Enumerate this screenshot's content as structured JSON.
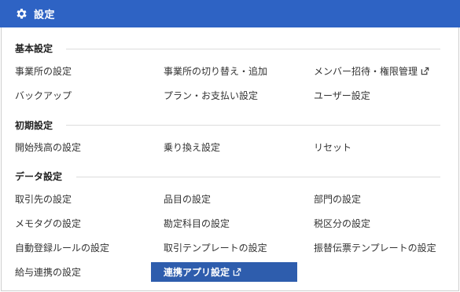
{
  "header": {
    "title": "設定"
  },
  "sections": [
    {
      "title": "基本設定",
      "items": [
        {
          "label": "事業所の設定"
        },
        {
          "label": "事業所の切り替え・追加"
        },
        {
          "label": "メンバー招待・権限管理"
        },
        {
          "label": "バックアップ"
        },
        {
          "label": "プラン・お支払い設定"
        },
        {
          "label": "ユーザー設定"
        }
      ]
    },
    {
      "title": "初期設定",
      "items": [
        {
          "label": "開始残高の設定"
        },
        {
          "label": "乗り換え設定"
        },
        {
          "label": "リセット"
        }
      ]
    },
    {
      "title": "データ設定",
      "items": [
        {
          "label": "取引先の設定"
        },
        {
          "label": "品目の設定"
        },
        {
          "label": "部門の設定"
        },
        {
          "label": "メモタグの設定"
        },
        {
          "label": "勘定科目の設定"
        },
        {
          "label": "税区分の設定"
        },
        {
          "label": "自動登録ルールの設定"
        },
        {
          "label": "取引テンプレートの設定"
        },
        {
          "label": "振替伝票テンプレートの設定"
        },
        {
          "label": "給与連携の設定"
        },
        {
          "label": "連携アプリ設定"
        }
      ]
    }
  ],
  "colors": {
    "header_bg": "#2e63c4",
    "active_bg": "#2e5dad"
  },
  "icons": {
    "header": "gear-icon",
    "external": "external-link-icon"
  }
}
